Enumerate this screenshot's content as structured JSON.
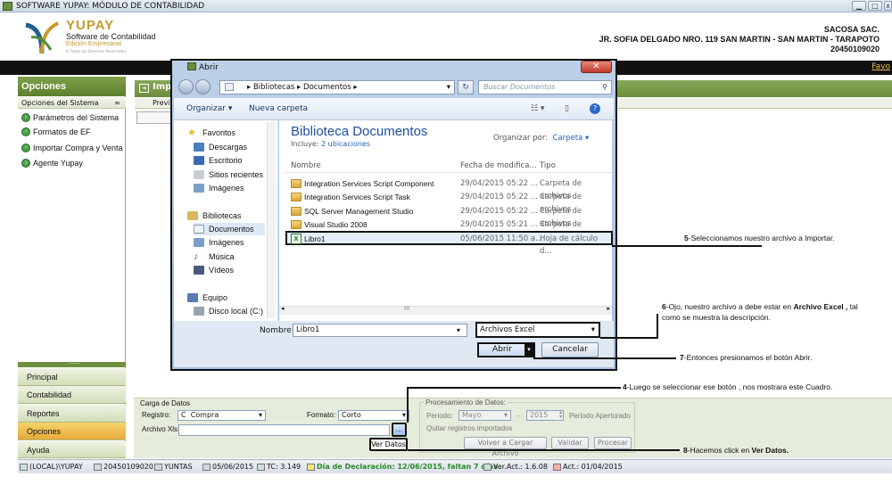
{
  "window": {
    "title": "SOFTWARE YUPAY: MÓDULO DE CONTABILIDAD"
  },
  "logo": {
    "name": "YUPAY",
    "subtitle": "Software de Contabilidad",
    "edition": "Edición Empresarial",
    "tiny": "El Todos los Derechos Reservados"
  },
  "company": {
    "name": "SACOSA SAC.",
    "address": "JR. SOFIA DELGADO NRO. 119 SAN MARTIN - SAN MARTIN - TARAPOTO",
    "ruc": "20450109020"
  },
  "favorites_link": "Favo",
  "sidebar": {
    "title": "Opciones",
    "subheader": "Opciones del Sistema",
    "items": [
      {
        "label": "Parámetros del Sistema"
      },
      {
        "label": "Formatos de EF"
      },
      {
        "label": "Importar Compra y Venta"
      },
      {
        "label": "Agente Yupay"
      }
    ],
    "grip": "......",
    "nav": [
      {
        "label": "Principal"
      },
      {
        "label": "Contabilidad"
      },
      {
        "label": "Reportes"
      },
      {
        "label": "Opciones"
      },
      {
        "label": "Ayuda"
      }
    ]
  },
  "main": {
    "header": "Imp",
    "subtab": "Previ"
  },
  "carga": {
    "title": "Carga de Datos",
    "registro_label": "Registro:",
    "registro_code": "C",
    "registro_value": "Compra",
    "formato_label": "Formato:",
    "formato_value": "Corto",
    "archivo_label": "Archivo Xls:",
    "browse_label": "...",
    "ver_datos": "Ver Datos"
  },
  "procesamiento": {
    "title": "Procesamiento de Datos:",
    "periodo_label": "Periodo:",
    "month": "Mayo",
    "year": "2015",
    "status": "Periodo Aperturado",
    "quitar": "Quitar registros importados",
    "btn_volver": "Volver a Cargar Archivo",
    "btn_validar": "Validar",
    "btn_procesar": "Procesar"
  },
  "statusbar": [
    {
      "text": "(LOCAL)\\YUPAY"
    },
    {
      "text": "20450109020"
    },
    {
      "text": "YUNTAS"
    },
    {
      "text": "05/06/2015"
    },
    {
      "text": "TC: 3.149"
    },
    {
      "text": "Día de Declaración: 12/06/2015, faltan 7 días"
    },
    {
      "text": "Ver.Act.: 1.6.08"
    },
    {
      "text": "Act.: 01/04/2015"
    }
  ],
  "dialog": {
    "title": "Abrir",
    "breadcrumb": "▸ Bibliotecas ▸ Documentos ▸",
    "search_placeholder": "Buscar Documentos",
    "organize": "Organizar ▾",
    "new_folder": "Nueva carpeta",
    "nav": [
      {
        "label": "Favoritos"
      },
      {
        "label": "Descargas"
      },
      {
        "label": "Escritorio"
      },
      {
        "label": "Sitios recientes"
      },
      {
        "label": "Imágenes"
      },
      {
        "label": "Bibliotecas"
      },
      {
        "label": "Documentos"
      },
      {
        "label": "Imágenes"
      },
      {
        "label": "Música"
      },
      {
        "label": "Vídeos"
      },
      {
        "label": "Equipo"
      },
      {
        "label": "Disco local (C:)"
      }
    ],
    "library_title": "Biblioteca Documentos",
    "includes_label": "Incluye:",
    "includes_link": "2 ubicaciones",
    "organize_by_label": "Organizar por:",
    "organize_by_value": "Carpeta ▾",
    "columns": {
      "name": "Nombre",
      "date": "Fecha de modifica...",
      "type": "Tipo"
    },
    "files": [
      {
        "name": "Integration Services Script Component",
        "date": "29/04/2015 05:22 ...",
        "type": "Carpeta de archivos"
      },
      {
        "name": "Integration Services Script Task",
        "date": "29/04/2015 05:22 ...",
        "type": "Carpeta de archivos"
      },
      {
        "name": "SQL Server Management Studio",
        "date": "29/04/2015 05:22 ...",
        "type": "Carpeta de archivos"
      },
      {
        "name": "Visual Studio 2008",
        "date": "29/04/2015 05:21 ...",
        "type": "Carpeta de archivos"
      },
      {
        "name": "Libro1",
        "date": "05/06/2015 11:50 a...",
        "type": "Hoja de cálculo d..."
      }
    ],
    "filename_label": "Nombre:",
    "filename_value": "Libro1",
    "filetype": "Archivos Excel",
    "open_button": "Abrir",
    "cancel_button": "Cancelar"
  },
  "annotations": {
    "a5_num": "5",
    "a5_text": "-Seleccionamos nuestro archivo a Importar.",
    "a6_num": "6",
    "a6_text1": "-Ojo, nuestro archivo a debe estar en ",
    "a6_bold": "Archivo Excel ,",
    "a6_text2": " tal",
    "a6_text3": "como se muestra la descripción.",
    "a7_num": "7",
    "a7_text": "-Entonces presionamos el botón Abrir.",
    "a4_num": "4",
    "a4_text": "-Luego se seleccionar ese botón , nos mostrara este  Cuadro.",
    "a8_num": "8",
    "a8_text": "-Hacemos click en ",
    "a8_bold": "Ver Datos."
  }
}
